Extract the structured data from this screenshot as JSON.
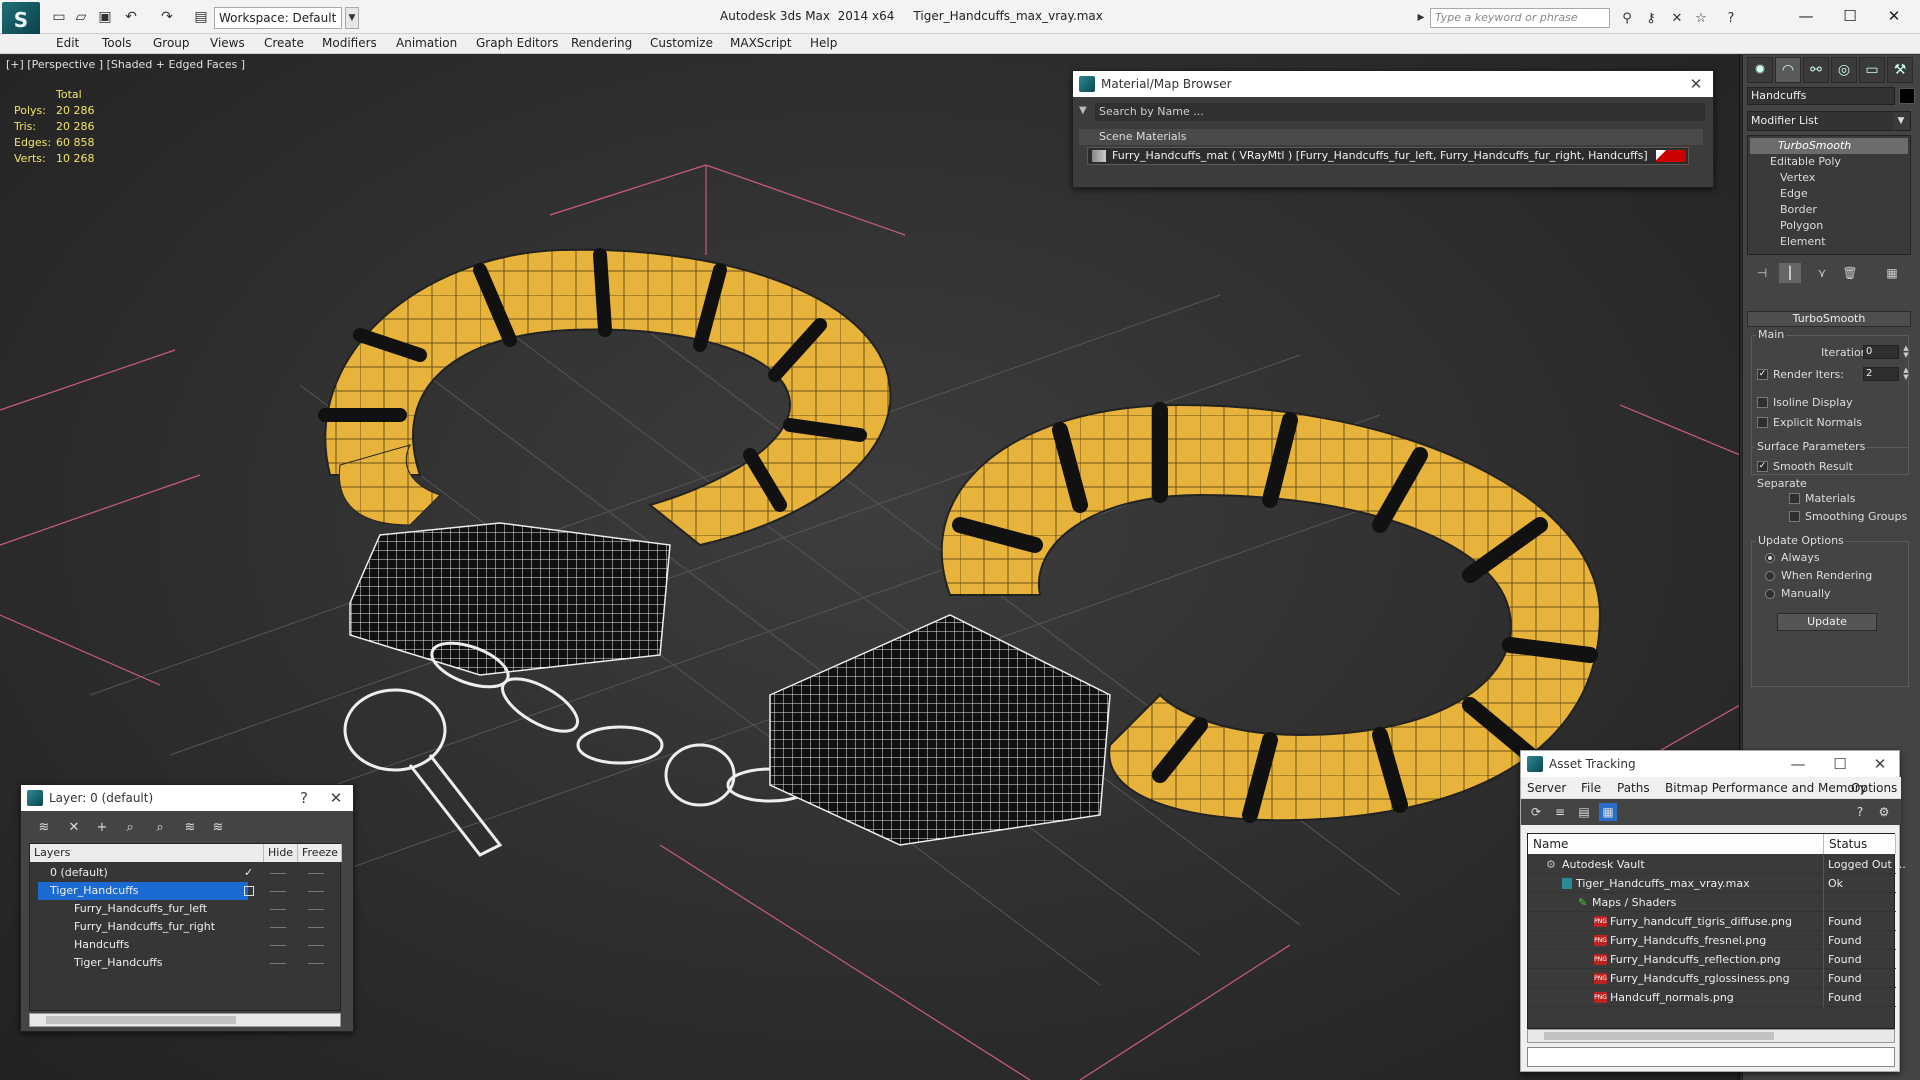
{
  "titlebar": {
    "app_title": "Autodesk 3ds Max  2014 x64     Tiger_Handcuffs_max_vray.max",
    "workspace": "Workspace: Default",
    "search_placeholder": "Type a keyword or phrase"
  },
  "menu": [
    "Edit",
    "Tools",
    "Group",
    "Views",
    "Create",
    "Modifiers",
    "Animation",
    "Graph Editors",
    "Rendering",
    "Customize",
    "MAXScript",
    "Help"
  ],
  "viewport": {
    "label": "[+] [Perspective ] [Shaded + Edged Faces ]",
    "stats_header": "Total",
    "stats": [
      {
        "label": "Polys:",
        "value": "20 286"
      },
      {
        "label": "Tris:",
        "value": "20 286"
      },
      {
        "label": "Edges:",
        "value": "60 858"
      },
      {
        "label": "Verts:",
        "value": "10 268"
      }
    ]
  },
  "material_browser": {
    "title": "Material/Map Browser",
    "search_placeholder": "Search by Name ...",
    "section": "Scene Materials",
    "row": "Furry_Handcuffs_mat  ( VRayMtl ) [Furry_Handcuffs_fur_left, Furry_Handcuffs_fur_right, Handcuffs]"
  },
  "command_panel": {
    "object_name": "Handcuffs",
    "modifier_list": "Modifier List",
    "stack": [
      "TurboSmooth",
      "Editable Poly",
      "Vertex",
      "Edge",
      "Border",
      "Polygon",
      "Element"
    ],
    "rollout": "TurboSmooth",
    "main": "Main",
    "iterations_label": "Iterations:",
    "iterations": "0",
    "render_iters_label": "Render Iters:",
    "render_iters": "2",
    "isoline": "Isoline Display",
    "explicit": "Explicit Normals",
    "surface_params": "Surface Parameters",
    "smooth_result": "Smooth Result",
    "separate": "Separate",
    "materials": "Materials",
    "smoothing_groups": "Smoothing Groups",
    "update_options": "Update Options",
    "always": "Always",
    "when_rendering": "When Rendering",
    "manually": "Manually",
    "update": "Update"
  },
  "layers": {
    "title": "Layer: 0 (default)",
    "help": "?",
    "col_layers": "Layers",
    "col_hide": "Hide",
    "col_freeze": "Freeze",
    "rows": [
      "0 (default)",
      "Tiger_Handcuffs",
      "Furry_Handcuffs_fur_left",
      "Furry_Handcuffs_fur_right",
      "Handcuffs",
      "Tiger_Handcuffs"
    ]
  },
  "asset_tracking": {
    "title": "Asset Tracking",
    "menu": [
      "Server",
      "File",
      "Paths",
      "Bitmap Performance and Memory",
      "Options"
    ],
    "col_name": "Name",
    "col_status": "Status",
    "rows": [
      {
        "name": "Autodesk Vault",
        "status": "Logged Out ..."
      },
      {
        "name": "Tiger_Handcuffs_max_vray.max",
        "status": "Ok"
      },
      {
        "name": "Maps / Shaders",
        "status": ""
      },
      {
        "name": "Furry_handcuff_tigris_diffuse.png",
        "status": "Found"
      },
      {
        "name": "Furry_Handcuffs_fresnel.png",
        "status": "Found"
      },
      {
        "name": "Furry_Handcuffs_reflection.png",
        "status": "Found"
      },
      {
        "name": "Furry_Handcuffs_rglossiness.png",
        "status": "Found"
      },
      {
        "name": "Handcuff_normals.png",
        "status": "Found"
      }
    ]
  },
  "colors": {
    "fur": "#e8b33a",
    "stripe": "#111111",
    "selection": "#1a6ad1",
    "stats": "#f2e36a"
  }
}
